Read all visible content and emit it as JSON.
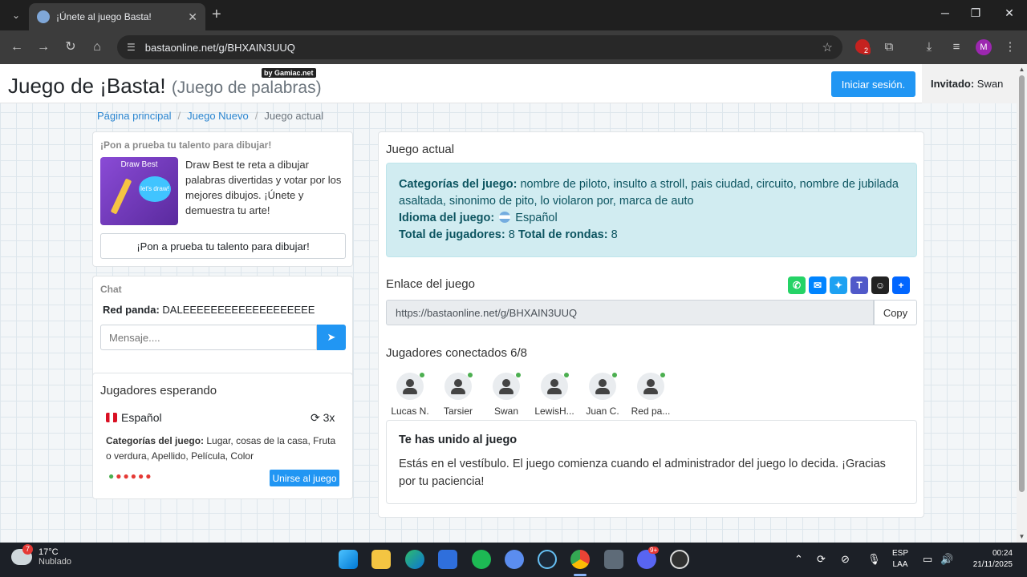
{
  "browser": {
    "tab_title": "¡Únete al juego Basta!",
    "tab_close": "✕",
    "new_tab": "+",
    "url": "bastaonline.net/g/BHXAIN3UUQ",
    "profile_initial": "M",
    "ext_badge": "2"
  },
  "site": {
    "brand_main": "Juego de ¡Basta!",
    "brand_sub": "(Juego de palabras)",
    "brand_badge": "by Gamiac.net",
    "login_label": "Iniciar sesión.",
    "guest_label": "Invitado:",
    "guest_name": "Swan"
  },
  "breadcrumb": {
    "home": "Página principal",
    "new_game": "Juego Nuevo",
    "current": "Juego actual"
  },
  "ad": {
    "title": "¡Pon a prueba tu talento para dibujar!",
    "image_caption": "Draw Best",
    "image_bubble": "let's draw!",
    "text": "Draw Best te reta a dibujar palabras divertidas y votar por los mejores dibujos. ¡Únete y demuestra tu arte!",
    "button_label": "¡Pon a prueba tu talento para dibujar!"
  },
  "chat": {
    "title": "Chat",
    "message_author": "Red panda:",
    "message_text": "DALEEEEEEEEEEEEEEEEEEE",
    "input_placeholder": "Mensaje....",
    "send_icon": "paper-plane-icon"
  },
  "waiting": {
    "title": "Jugadores esperando",
    "language": "Español",
    "rounds": "3x",
    "categories_label": "Categorías del juego:",
    "categories_value": "Lugar, cosas de la casa, Fruta o verdura, Apellido, Película, Color",
    "join_label": "Unirse al juego",
    "player_slots_filled": 1,
    "player_slots_total": 6
  },
  "game": {
    "heading": "Juego actual",
    "categories_label": "Categorías del juego:",
    "categories_value": "nombre de piloto, insulto a stroll, pais ciudad, circuito, nombre de jubilada asaltada, sinonimo de pito, lo violaron por, marca de auto",
    "language_label": "Idioma del juego:",
    "language_value": "Español",
    "players_label": "Total de jugadores:",
    "players_value": "8",
    "rounds_label": "Total de rondas:",
    "rounds_value": "8",
    "link_label": "Enlace del juego",
    "link_value": "https://bastaonline.net/g/BHXAIN3UUQ",
    "copy_label": "Copy",
    "connected_label": "Jugadores conectados",
    "connected_count": "6/8",
    "players": [
      "Lucas N.",
      "Tarsier",
      "Swan",
      "LewisH...",
      "Juan C.",
      "Red pa..."
    ],
    "joined_title": "Te has unido al juego",
    "joined_text": "Estás en el vestíbulo. El juego comienza cuando el administrador del juego lo decida. ¡Gracias por tu paciencia!",
    "share_colors": {
      "whatsapp": "#25d366",
      "messenger": "#0084ff",
      "twitter": "#1da1f2",
      "teams": "#5059c9",
      "snapchat": "#222222",
      "more": "#0166ff"
    }
  },
  "taskbar": {
    "temperature": "17°C",
    "weather": "Nublado",
    "weather_badge": "7",
    "lang_top": "ESP",
    "lang_bottom": "LAA",
    "time": "00:24",
    "date": "21/11/2025",
    "discord_badge": "9+"
  },
  "colors": {
    "accent": "#2196f3",
    "info_bg": "#d1ecf1",
    "info_text": "#0c5460",
    "online": "#4caf50"
  }
}
